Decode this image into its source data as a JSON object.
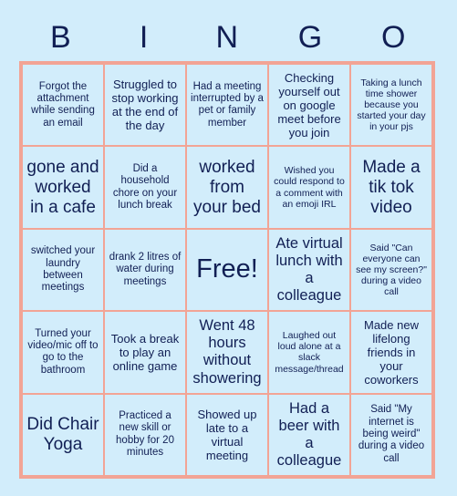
{
  "header": {
    "letters": [
      "B",
      "I",
      "N",
      "G",
      "O"
    ]
  },
  "colors": {
    "background": "#d2edfb",
    "cell_fill": "#d2edfb",
    "border": "#f2a495",
    "text": "#111f54"
  },
  "grid": {
    "columns": 5,
    "rows": 5,
    "free_space_index": 12,
    "cells": [
      {
        "text": "Forgot the attachment while sending an email",
        "size": "sm"
      },
      {
        "text": "Struggled to stop working at the end of the day",
        "size": "md"
      },
      {
        "text": "Had a meeting interrupted by a pet or family member",
        "size": "sm"
      },
      {
        "text": "Checking yourself out on google meet before you join",
        "size": "md"
      },
      {
        "text": "Taking a lunch time shower because you started your day in your pjs",
        "size": "xs"
      },
      {
        "text": "gone and worked in a cafe",
        "size": "xl"
      },
      {
        "text": "Did a household chore on your lunch break",
        "size": "sm"
      },
      {
        "text": "worked from your bed",
        "size": "xl"
      },
      {
        "text": "Wished you could respond to a comment with an emoji IRL",
        "size": "xs"
      },
      {
        "text": "Made a tik tok video",
        "size": "xl"
      },
      {
        "text": "switched your laundry between meetings",
        "size": "sm"
      },
      {
        "text": "drank 2 litres of water during meetings",
        "size": "sm"
      },
      {
        "text": "Free!",
        "size": "xxl"
      },
      {
        "text": "Ate virtual lunch with a colleague",
        "size": "lg"
      },
      {
        "text": "Said \"Can everyone can see my screen?\" during a video call",
        "size": "xs"
      },
      {
        "text": "Turned your video/mic off to go to the bathroom",
        "size": "sm"
      },
      {
        "text": "Took a break to play an online game",
        "size": "md"
      },
      {
        "text": "Went 48 hours without showering",
        "size": "lg"
      },
      {
        "text": "Laughed out loud alone at a slack message/thread",
        "size": "xs"
      },
      {
        "text": "Made new lifelong friends in your coworkers",
        "size": "md"
      },
      {
        "text": "Did Chair Yoga",
        "size": "xl"
      },
      {
        "text": "Practiced a new skill or hobby for 20 minutes",
        "size": "sm"
      },
      {
        "text": "Showed up late to a virtual meeting",
        "size": "md"
      },
      {
        "text": "Had a beer with a colleague",
        "size": "lg"
      },
      {
        "text": "Said \"My internet is being weird\" during a video call",
        "size": "sm"
      }
    ]
  }
}
